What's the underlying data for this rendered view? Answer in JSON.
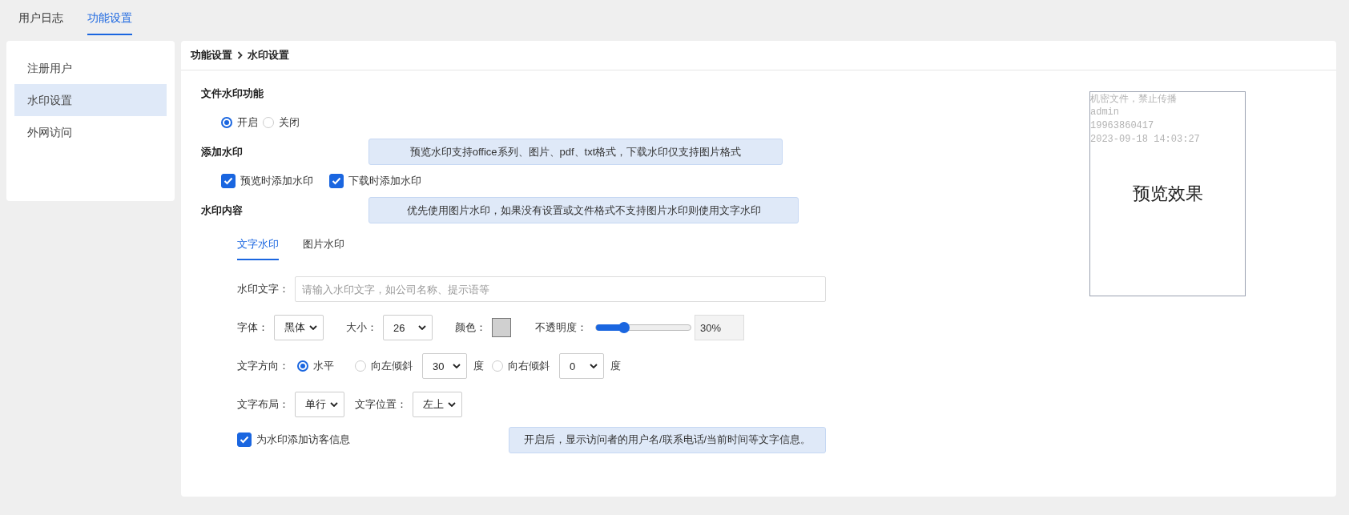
{
  "top_tabs": [
    {
      "label": "用户日志",
      "selected": false
    },
    {
      "label": "功能设置",
      "selected": true
    }
  ],
  "sidebar": {
    "items": [
      {
        "label": "注册用户",
        "selected": false
      },
      {
        "label": "水印设置",
        "selected": true
      },
      {
        "label": "外网访问",
        "selected": false
      }
    ]
  },
  "breadcrumb": [
    "功能设置",
    "水印设置"
  ],
  "file_watermark": {
    "label": "文件水印功能",
    "options": [
      {
        "label": "开启",
        "selected": true
      },
      {
        "label": "关闭",
        "selected": false
      }
    ]
  },
  "add_watermark": {
    "label": "添加水印",
    "note": "预览水印支持office系列、图片、pdf、txt格式，下载水印仅支持图片格式",
    "options": [
      {
        "label": "预览时添加水印",
        "checked": true
      },
      {
        "label": "下载时添加水印",
        "checked": true
      }
    ]
  },
  "watermark_content": {
    "label": "水印内容",
    "note": "优先使用图片水印，如果没有设置或文件格式不支持图片水印则使用文字水印",
    "tabs": [
      {
        "label": "文字水印",
        "selected": true
      },
      {
        "label": "图片水印",
        "selected": false
      }
    ],
    "text_field": {
      "label": "水印文字：",
      "placeholder": "请输入水印文字，如公司名称、提示语等"
    },
    "font": {
      "label": "字体：",
      "value": "黑体"
    },
    "size": {
      "label": "大小：",
      "value": "26"
    },
    "color": {
      "label": "颜色：",
      "color": "#d0d0d0"
    },
    "opacity": {
      "label": "不透明度：",
      "level": 0.3,
      "reading": "30%"
    },
    "direction": {
      "label": "文字方向：",
      "options": [
        {
          "label": "水平",
          "selected": true
        },
        {
          "label": "向左倾斜",
          "selected": false,
          "angle": "30",
          "unit": "度"
        },
        {
          "label": "向右倾斜",
          "selected": false,
          "angle": "0",
          "unit": "度"
        }
      ]
    },
    "layout": {
      "label": "文字布局：",
      "value": "单行"
    },
    "position": {
      "label": "文字位置：",
      "value": "左上"
    },
    "visitor_info": {
      "label": "为水印添加访客信息",
      "checked": true,
      "note": "开启后，显示访问者的用户名/联系电话/当前时间等文字信息。"
    }
  },
  "preview": {
    "watermark_lines": [
      "机密文件，禁止传播",
      "admin",
      "19963860417",
      "2023-09-18 14:03:27"
    ],
    "title": "预览效果"
  }
}
